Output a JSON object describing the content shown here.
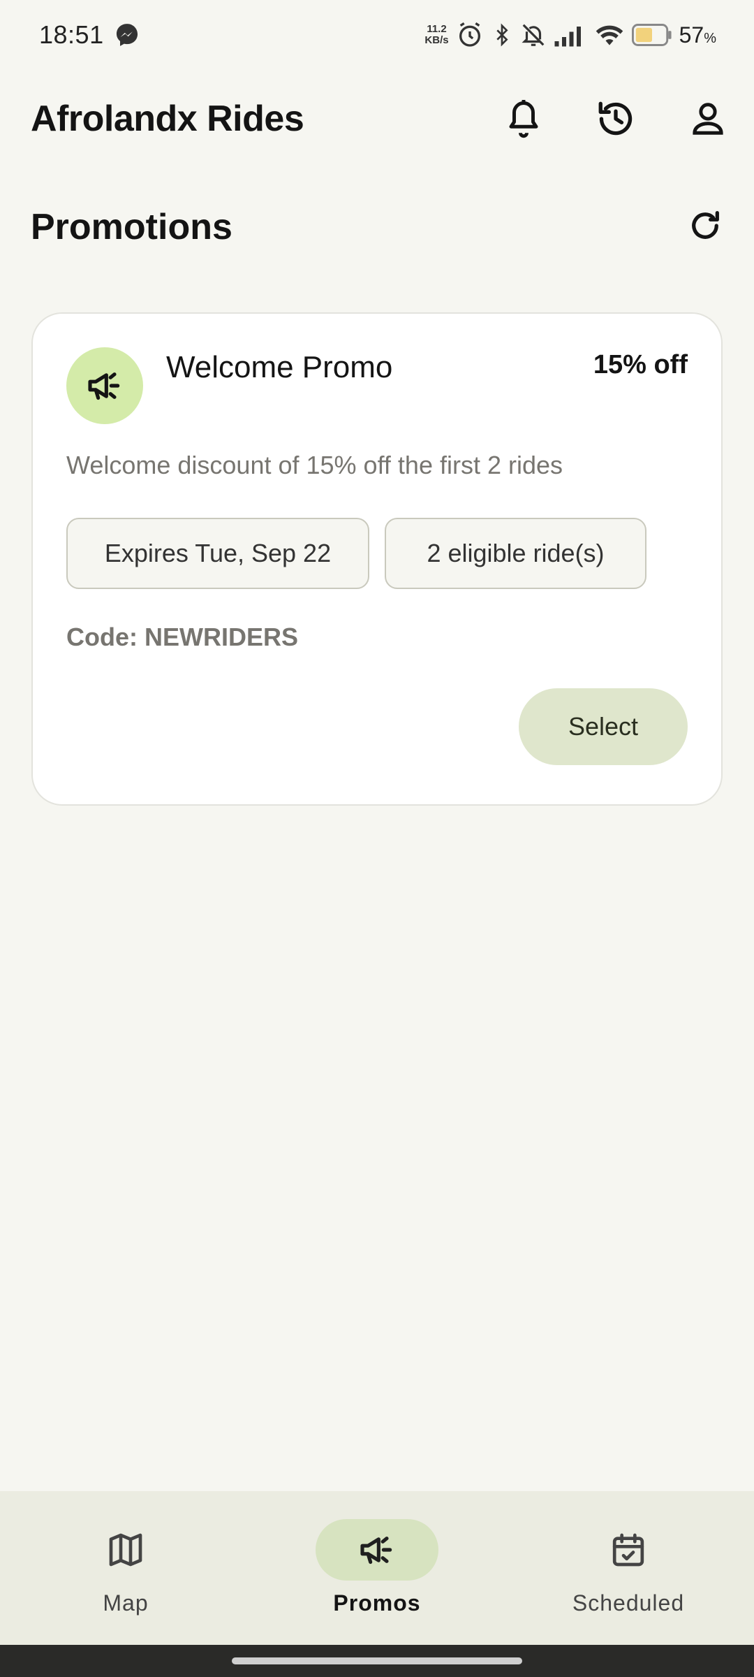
{
  "status_bar": {
    "time": "18:51",
    "net_speed_value": "11.2",
    "net_speed_unit": "KB/s",
    "battery_percent": "57",
    "battery_percent_suffix": "%",
    "icons": [
      "messenger-icon",
      "alarm-icon",
      "bluetooth-icon",
      "mute-icon",
      "signal-icon",
      "wifi-icon",
      "battery-icon"
    ]
  },
  "app_bar": {
    "title": "Afrolandx Rides",
    "actions": [
      "bell-icon",
      "history-icon",
      "profile-icon"
    ]
  },
  "section": {
    "title": "Promotions",
    "refresh_icon": "refresh-icon"
  },
  "promo": {
    "icon": "megaphone-icon",
    "title": "Welcome Promo",
    "discount": "15% off",
    "description": "Welcome discount of 15% off the first 2 rides",
    "expires": "Expires Tue, Sep 22",
    "eligible_rides": "2 eligible ride(s)",
    "code": "Code: NEWRIDERS",
    "select_label": "Select"
  },
  "bottom_nav": {
    "items": [
      {
        "label": "Map",
        "icon": "map-icon",
        "active": false
      },
      {
        "label": "Promos",
        "icon": "megaphone-icon",
        "active": true
      },
      {
        "label": "Scheduled",
        "icon": "calendar-check-icon",
        "active": false
      }
    ]
  },
  "colors": {
    "background": "#f6f6f1",
    "accent_soft": "#d4eba9",
    "select_button": "#dfe6cc",
    "nav_background": "#ebece1",
    "nav_active_pill": "#d7e3c0"
  }
}
